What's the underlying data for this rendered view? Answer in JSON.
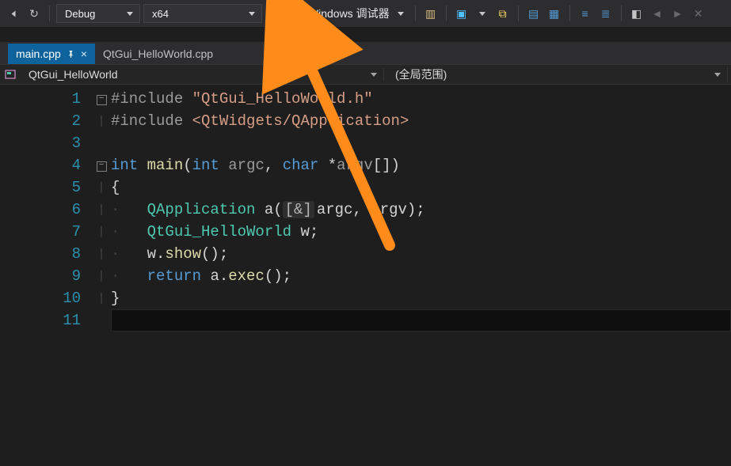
{
  "toolbar": {
    "config_dropdown": "Debug",
    "platform_dropdown": "x64",
    "debug_button": "本地 Windows 调试器"
  },
  "tabs": [
    {
      "label": "main.cpp",
      "active": true,
      "pinned": true
    },
    {
      "label": "QtGui_HelloWorld.cpp",
      "active": false,
      "pinned": false
    }
  ],
  "context": {
    "project": "QtGui_HelloWorld",
    "scope": "(全局范围)"
  },
  "code": {
    "lines": [
      {
        "n": "1",
        "fold": "minus",
        "html": "<span class='pp'>#include </span><span class='str'>\"QtGui_HelloWorld.h\"</span>"
      },
      {
        "n": "2",
        "fold": "bar",
        "html": "<span class='pp'>#include </span><span class='str'>&lt;QtWidgets/QApplication&gt;</span>"
      },
      {
        "n": "3",
        "fold": "",
        "html": ""
      },
      {
        "n": "4",
        "fold": "minus",
        "html": "<span class='kw'>int</span> <span class='fn'>main</span><span class='pun'>(</span><span class='kw'>int</span> <span class='param'>argc</span><span class='pun'>,</span> <span class='kw'>char</span> <span class='pun'>*</span><span class='param'>argv</span><span class='pun'>[])</span>"
      },
      {
        "n": "5",
        "fold": "bar",
        "html": "<span class='pun'>{</span>"
      },
      {
        "n": "6",
        "fold": "bar",
        "html": "<span class='indent'>·   </span><span class='typ'>QApplication</span> <span class='id'>a</span><span class='pun'>(</span><span class='hint'>[&amp;]</span><span class='id'>argc</span><span class='pun'>,</span> <span class='id'>argv</span><span class='pun'>);</span>"
      },
      {
        "n": "7",
        "fold": "bar",
        "html": "<span class='indent'>·   </span><span class='typ'>QtGui_HelloWorld</span> <span class='id'>w</span><span class='pun'>;</span>"
      },
      {
        "n": "8",
        "fold": "bar",
        "html": "<span class='indent'>·   </span><span class='id'>w</span><span class='pun'>.</span><span class='fn'>show</span><span class='pun'>();</span>"
      },
      {
        "n": "9",
        "fold": "bar",
        "html": "<span class='indent'>·   </span><span class='kw'>return</span> <span class='id'>a</span><span class='pun'>.</span><span class='fn'>exec</span><span class='pun'>();</span>"
      },
      {
        "n": "10",
        "fold": "bar",
        "html": "<span class='pun'>}</span>"
      },
      {
        "n": "11",
        "fold": "",
        "html": "",
        "current": true
      }
    ]
  }
}
